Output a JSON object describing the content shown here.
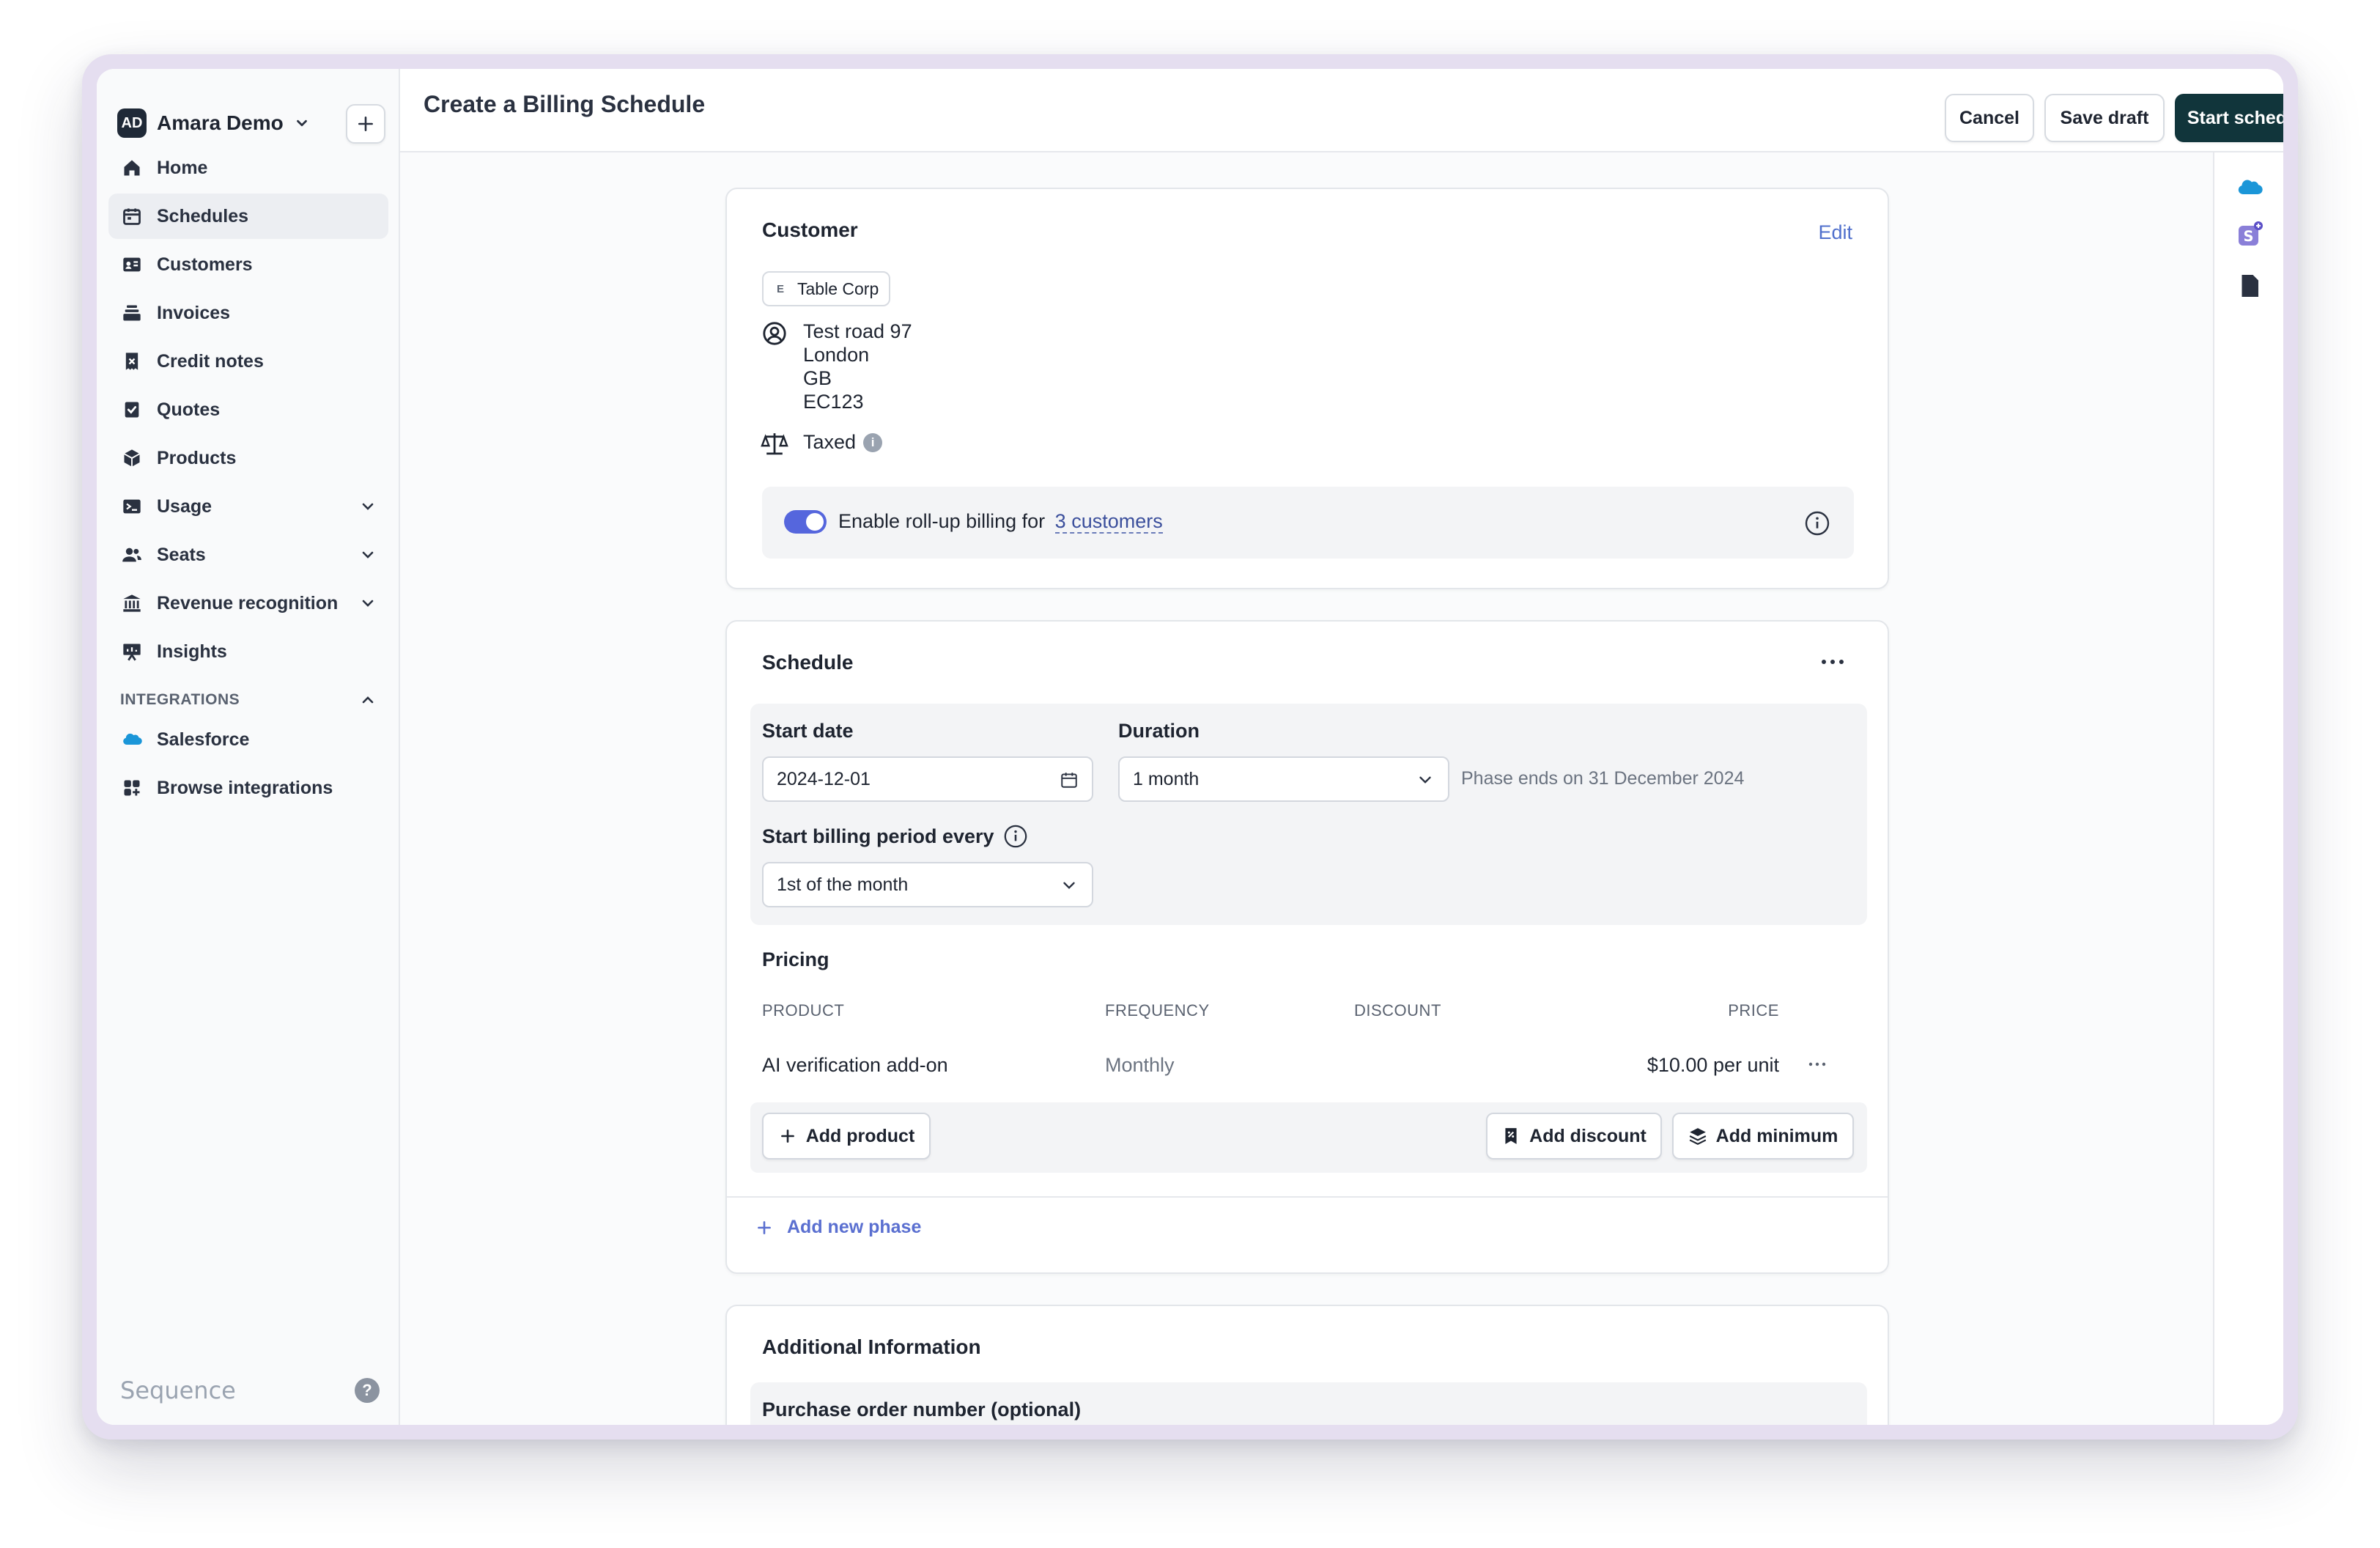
{
  "workspace": {
    "avatar": "AD",
    "name": "Amara Demo"
  },
  "nav": {
    "items": [
      {
        "label": "Home",
        "icon": "home-icon"
      },
      {
        "label": "Schedules",
        "icon": "calendar-icon",
        "active": true
      },
      {
        "label": "Customers",
        "icon": "id-card-icon"
      },
      {
        "label": "Invoices",
        "icon": "invoice-stack-icon"
      },
      {
        "label": "Credit notes",
        "icon": "receipt-icon"
      },
      {
        "label": "Quotes",
        "icon": "check-document-icon"
      },
      {
        "label": "Products",
        "icon": "cube-icon"
      },
      {
        "label": "Usage",
        "icon": "terminal-icon",
        "expandable": true
      },
      {
        "label": "Seats",
        "icon": "users-icon",
        "expandable": true
      },
      {
        "label": "Revenue recognition",
        "icon": "bank-icon",
        "expandable": true
      },
      {
        "label": "Insights",
        "icon": "presentation-chart-icon"
      }
    ],
    "integrations_heading": "INTEGRATIONS",
    "integrations": [
      {
        "label": "Salesforce",
        "icon": "salesforce-cloud-icon"
      },
      {
        "label": "Browse integrations",
        "icon": "grid-icon"
      }
    ]
  },
  "brand": "Sequence",
  "header": {
    "title": "Create a Billing Schedule",
    "cancel_label": "Cancel",
    "save_draft_label": "Save draft",
    "start_label": "Start schedule"
  },
  "customer_card": {
    "title": "Customer",
    "edit_label": "Edit",
    "customer_initial": "E",
    "customer_name": "Table Corp",
    "address": [
      "Test road 97",
      "London",
      "GB",
      "EC123"
    ],
    "tax_status": "Taxed",
    "rollup_text": "Enable roll-up billing for",
    "rollup_link": "3 customers",
    "rollup_enabled": true
  },
  "schedule_card": {
    "title": "Schedule",
    "start_date_label": "Start date",
    "start_date_value": "2024-12-01",
    "duration_label": "Duration",
    "duration_value": "1 month",
    "phase_end_text": "Phase ends on 31 December 2024",
    "billing_period_label": "Start billing period every",
    "billing_period_value": "1st of the month",
    "pricing_title": "Pricing",
    "columns": {
      "product": "PRODUCT",
      "frequency": "FREQUENCY",
      "discount": "DISCOUNT",
      "price": "PRICE"
    },
    "rows": [
      {
        "product": "AI verification add-on",
        "frequency": "Monthly",
        "discount": "",
        "price": "$10.00 per unit"
      }
    ],
    "add_product_label": "Add product",
    "add_discount_label": "Add discount",
    "add_minimum_label": "Add minimum",
    "add_phase_label": "Add new phase"
  },
  "additional_card": {
    "title": "Additional Information",
    "po_label": "Purchase order number (optional)"
  },
  "colors": {
    "primary": "#11353b",
    "accent": "#5566dd",
    "link": "#4f6fcc"
  }
}
